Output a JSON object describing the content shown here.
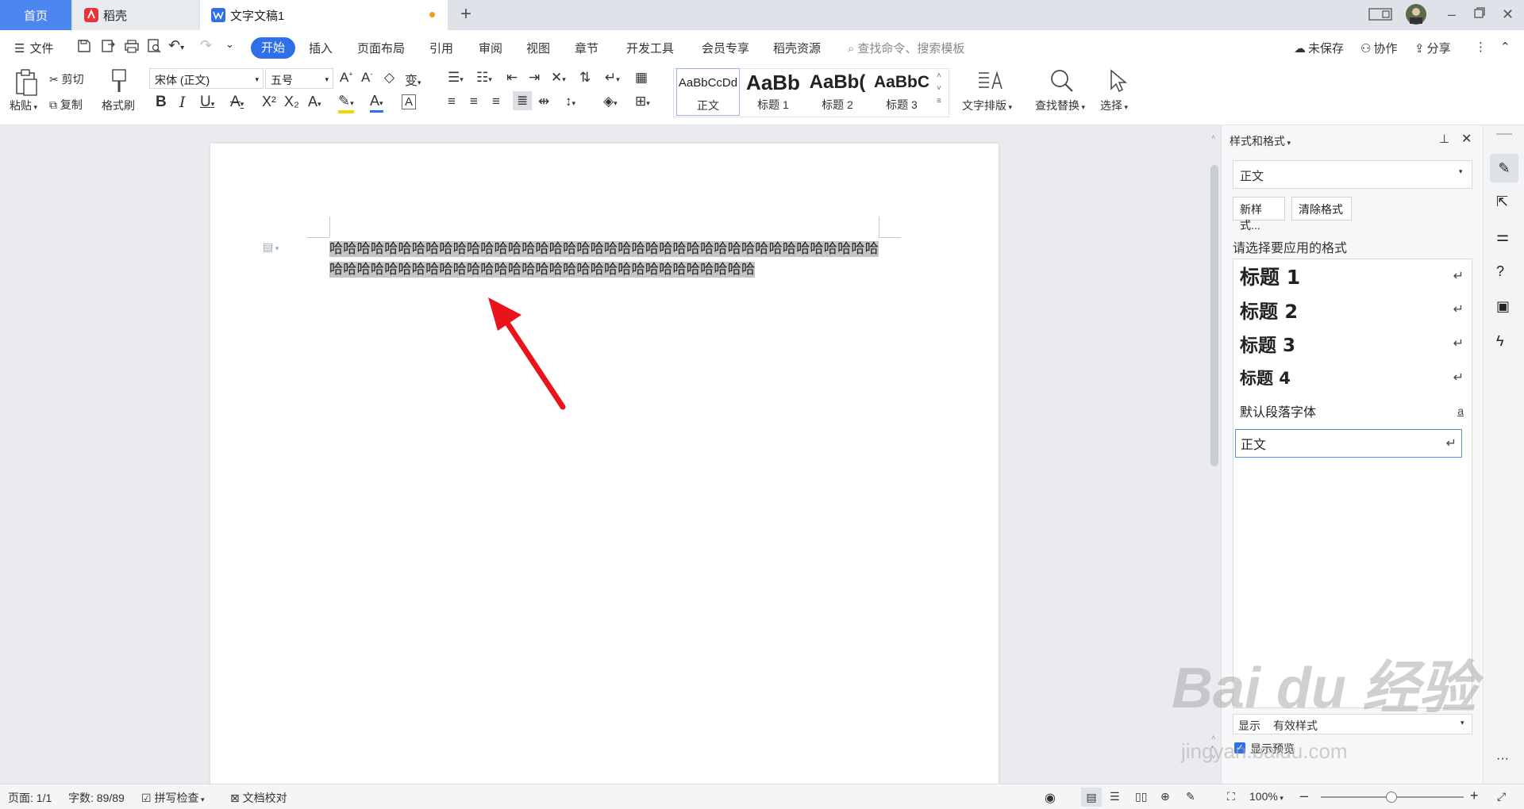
{
  "tabs": {
    "home": "首页",
    "daoke": "稻壳",
    "doc": "文字文稿1",
    "add": "+"
  },
  "menu": {
    "file": "文件",
    "start": "开始",
    "insert": "插入",
    "layout": "页面布局",
    "reference": "引用",
    "review": "审阅",
    "view": "视图",
    "chapter": "章节",
    "dev": "开发工具",
    "member": "会员专享",
    "resources": "稻壳资源",
    "search_placeholder": "查找命令、搜索模板",
    "unsaved": "未保存",
    "collab": "协作",
    "share": "分享"
  },
  "ribbon": {
    "paste": "粘贴",
    "cut": "剪切",
    "copy": "复制",
    "format_painter": "格式刷",
    "font_name": "宋体 (正文)",
    "font_size": "五号",
    "styles": [
      {
        "preview": "AaBbCcDd",
        "name": "正文"
      },
      {
        "preview": "AaBb",
        "name": "标题 1"
      },
      {
        "preview": "AaBb(",
        "name": "标题 2"
      },
      {
        "preview": "AaBbC",
        "name": "标题 3"
      }
    ],
    "text_layout": "文字排版",
    "find_replace": "查找替换",
    "select": "选择"
  },
  "document": {
    "content": "哈哈哈哈哈哈哈哈哈哈哈哈哈哈哈哈哈哈哈哈哈哈哈哈哈哈哈哈哈哈哈哈哈哈哈哈哈哈哈哈哈哈哈哈哈哈哈哈哈哈哈哈哈哈哈哈哈哈哈哈哈哈哈哈哈哈哈哈哈哈哈"
  },
  "panel": {
    "title": "样式和格式",
    "current_style": "正文",
    "new_style": "新样式...",
    "clear_format": "清除格式",
    "choose_label": "请选择要应用的格式",
    "styles": [
      {
        "name": "标题  1",
        "mark": "↵"
      },
      {
        "name": "标题  2",
        "mark": "↵"
      },
      {
        "name": "标题  3",
        "mark": "↵"
      },
      {
        "name": "标题  4",
        "mark": "↵"
      },
      {
        "name": "默认段落字体",
        "mark": "a"
      },
      {
        "name": "正文",
        "mark": "↵"
      }
    ],
    "show_label": "显示",
    "show_value": "有效样式",
    "preview_label": "显示预览"
  },
  "status": {
    "page": "页面: 1/1",
    "words": "字数: 89/89",
    "spell": "拼写检查",
    "proof": "文档校对",
    "zoom": "100%",
    "zoom_level": 0.5
  },
  "watermark": {
    "logo": "Bai du 经验",
    "url": "jingyan.baidu.com"
  },
  "colors": {
    "accent": "#2f6fe8",
    "selection": "#c5c5c5",
    "arrow": "#e8141a"
  }
}
